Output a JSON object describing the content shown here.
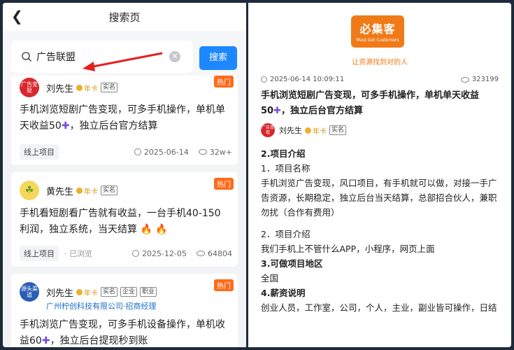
{
  "left": {
    "title": "搜索页",
    "back_icon": "chevron-left-icon",
    "search": {
      "value": "广告联盟",
      "button_label": "搜索"
    },
    "cards": [
      {
        "hot": "热门",
        "avatar_text": "广告变现",
        "author": "刘先生",
        "year_badge": "年卡",
        "tags": [
          "实名"
        ],
        "text_a": "手机浏览短剧广告变现，可多手机操作，单机单天收益50",
        "text_b": "，独立后台官方结算",
        "chip": "线上项目",
        "date": "2025-06-14",
        "views": "32w+"
      },
      {
        "hot": "热门",
        "author": "黄先生",
        "year_badge": "年卡",
        "tags": [
          "实名"
        ],
        "text_a": "手机看短剧看广告就有收益，一台手机40-150利润，独立系统，当天结算",
        "chip": "线上项目",
        "browsed": "· 已浏览",
        "date": "2025-12-05",
        "views": "64804"
      },
      {
        "hot": "热门",
        "avatar_text": "源头渠道",
        "author": "刘先生",
        "year_badge": "年卡",
        "tags": [
          "实名",
          "企业",
          "职业"
        ],
        "company": "广州柠创科技有限公司·招商经理",
        "text_a": "手机浏览广告变现，可多手机设备操作，单机收益60",
        "text_b": "，独立后台提现秒到账"
      }
    ]
  },
  "right": {
    "logo": "必集客",
    "logo_sub": "Must Get Customers",
    "slogan": "让资源找到对的人",
    "datetime": "2025-06-14 10:09:11",
    "views": "323199",
    "title_a": "手机浏览短剧广告变现，可多手机操作，单机单天收益50",
    "title_b": "，独立后台官方结算",
    "avatar_text": "广告变现",
    "author": "刘先生",
    "year_badge": "年卡",
    "tag": "实名",
    "sections": {
      "s2": "2.项目介绍",
      "s2_1": "1．项目名称",
      "s2_1_text": "手机浏览广告变现，风口项目，有手机就可以做，对接一手广告资源，长期稳定，独立后台当天结算，总部招合伙人，兼职勿扰（合作有费用）",
      "s2_2": "2．项目介绍",
      "s2_2_text": "我们手机上不管什么APP，小程序，网页上面",
      "s3": "3.可做项目地区",
      "s3_text": "全国",
      "s4": "4.薪资说明",
      "s4_text": "创业人员，工作室，公司，个人，主业，副业皆可操作，日结"
    }
  }
}
